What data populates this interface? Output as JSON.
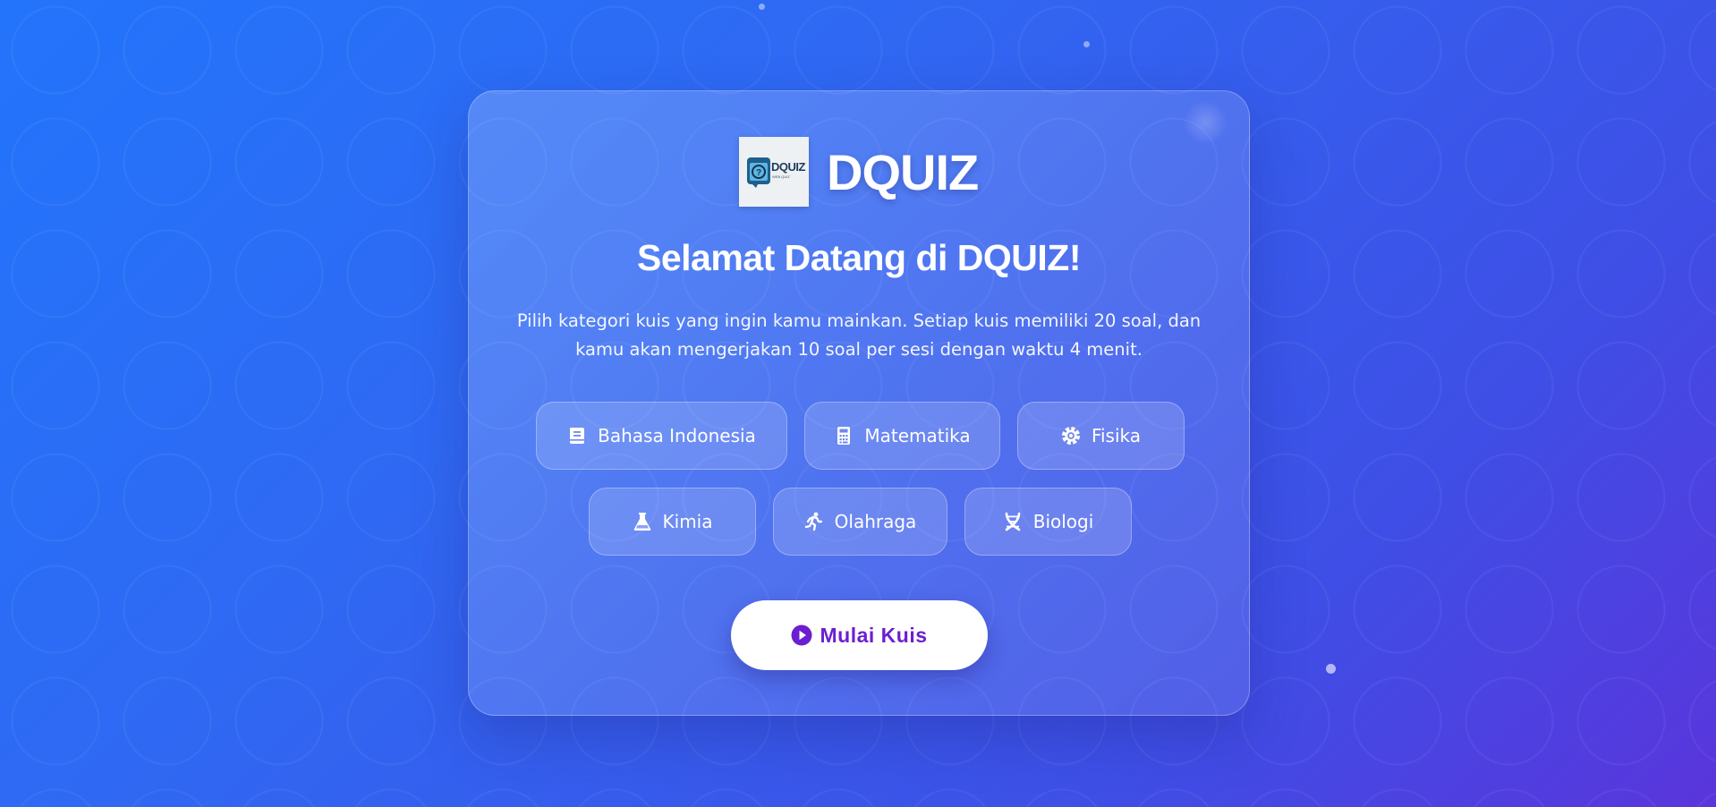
{
  "app": {
    "logo_text": "DQUIZ",
    "logo_subtext": "WEB QUIZ",
    "brand_name": "DQUIZ"
  },
  "welcome": {
    "title": "Selamat Datang di DQUIZ!",
    "description": "Pilih kategori kuis yang ingin kamu mainkan. Setiap kuis memiliki 20 soal, dan kamu akan mengerjakan 10 soal per sesi dengan waktu 4 menit."
  },
  "categories": [
    {
      "label": "Bahasa Indonesia",
      "icon": "book-icon"
    },
    {
      "label": "Matematika",
      "icon": "calculator-icon"
    },
    {
      "label": "Fisika",
      "icon": "atom-gear-icon"
    },
    {
      "label": "Kimia",
      "icon": "flask-icon"
    },
    {
      "label": "Olahraga",
      "icon": "running-icon"
    },
    {
      "label": "Biologi",
      "icon": "dna-icon"
    }
  ],
  "start_button": {
    "label": "Mulai Kuis",
    "icon": "play-circle-icon"
  },
  "colors": {
    "background_start": "#2374fb",
    "background_end": "#5a35dc",
    "button_text": "#6b1fd1"
  }
}
